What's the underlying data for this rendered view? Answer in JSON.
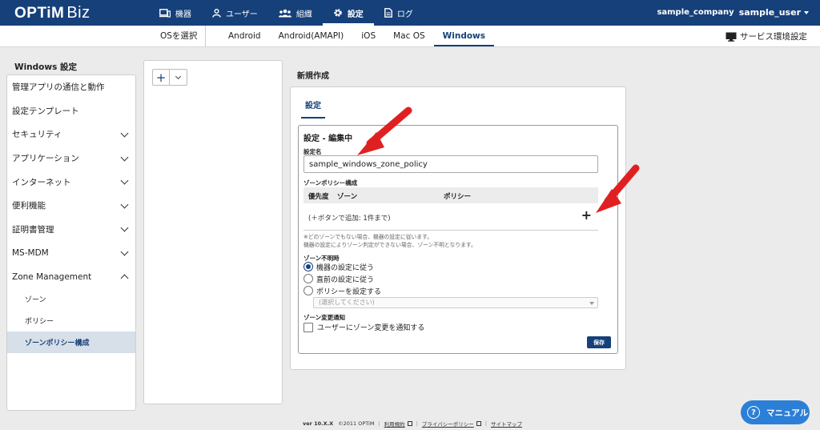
{
  "header": {
    "logo": "OPTiM",
    "logo_suffix": "Biz",
    "nav": [
      {
        "label": "機器",
        "icon": "device-icon"
      },
      {
        "label": "ユーザー",
        "icon": "user-icon"
      },
      {
        "label": "組織",
        "icon": "organization-icon"
      },
      {
        "label": "設定",
        "icon": "gear-icon",
        "active": true
      },
      {
        "label": "ログ",
        "icon": "log-icon"
      }
    ],
    "company": "sample_company",
    "user": "sample_user"
  },
  "os_bar": {
    "select_label": "OSを選択",
    "tabs": [
      "Android",
      "Android(AMAPI)",
      "iOS",
      "Mac OS",
      "Windows"
    ],
    "active_tab": "Windows",
    "service_settings": "サービス環境設定"
  },
  "sidebar": {
    "title": "Windows 設定",
    "items": [
      {
        "label": "管理アプリの通信と動作"
      },
      {
        "label": "設定テンプレート"
      },
      {
        "label": "セキュリティ"
      },
      {
        "label": "アプリケーション"
      },
      {
        "label": "インターネット"
      },
      {
        "label": "便利機能"
      },
      {
        "label": "証明書管理"
      },
      {
        "label": "MS-MDM"
      },
      {
        "label": "Zone Management"
      }
    ],
    "sub_items": [
      {
        "label": "ゾーン"
      },
      {
        "label": "ポリシー"
      },
      {
        "label": "ゾーンポリシー構成"
      }
    ]
  },
  "main": {
    "title": "新規作成",
    "tab": "設定",
    "edit_title": "設定 - 編集中",
    "name_label": "設定名",
    "name_value": "sample_windows_zone_policy",
    "zone_policy_label": "ゾーンポリシー構成",
    "table_headers": [
      "優先度",
      "ゾーン",
      "ポリシー"
    ],
    "empty_row": "(＋ボタンで追加: 1件まで)",
    "add_symbol": "+",
    "note_line1": "※どのゾーンでもない場合、機器の設定に従います。",
    "note_line2": "機器の設定によりゾーン判定ができない場合、ゾーン不明となります。",
    "unknown_label": "ゾーン不明時",
    "radio_options": [
      "機器の設定に従う",
      "直前の設定に従う",
      "ポリシーを設定する"
    ],
    "radio_selected": 0,
    "policy_placeholder": "(選択してください)",
    "notify_label": "ゾーン変更通知",
    "notify_checkbox": "ユーザーにゾーン変更を通知する",
    "save": "保存"
  },
  "footer": {
    "version": "ver 10.X.X",
    "copyright": "©2011 OPTiM",
    "terms": "利用規約",
    "privacy": "プライバシーポリシー",
    "sitemap": "サイトマップ"
  },
  "manual": "マニュアル",
  "colors": {
    "header_bg": "#16407a",
    "accent": "#16407a",
    "manual_button": "#2c7fd6",
    "annotation_arrow": "#e02020"
  }
}
